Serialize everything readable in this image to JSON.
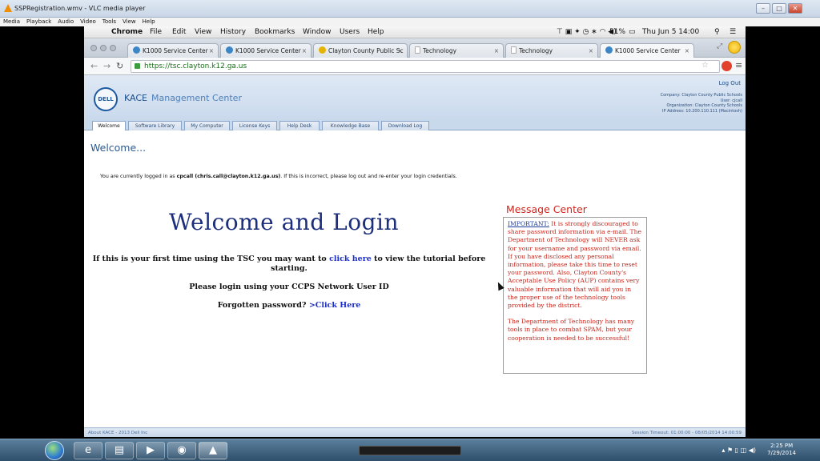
{
  "vlc": {
    "title": "SSPRegistration.wmv - VLC media player",
    "menu": [
      "Media",
      "Playback",
      "Audio",
      "Video",
      "Tools",
      "View",
      "Help"
    ]
  },
  "mac_menubar": {
    "app": "Chrome",
    "items": [
      "File",
      "Edit",
      "View",
      "History",
      "Bookmarks",
      "Window",
      "Users",
      "Help"
    ],
    "battery": "51%",
    "datetime": "Thu Jun 5  14:00"
  },
  "browser": {
    "tabs": [
      {
        "label": "K1000 Service Center",
        "icon": "kace-icon",
        "active": false
      },
      {
        "label": "K1000 Service Center",
        "icon": "kace-icon",
        "active": false
      },
      {
        "label": "Clayton County Public Sc",
        "icon": "county-icon",
        "active": false
      },
      {
        "label": "Technology",
        "icon": "doc-icon",
        "active": false
      },
      {
        "label": "Technology",
        "icon": "doc-icon",
        "active": false
      },
      {
        "label": "K1000 Service Center",
        "icon": "kace-icon",
        "active": true
      }
    ],
    "url": "https://tsc.clayton.k12.ga.us"
  },
  "kace": {
    "logo_text": "DELL",
    "product": "KACE",
    "subtitle": "Management Center",
    "logout": "Log Out",
    "company_lines": [
      "Company: Clayton County Public Schools",
      "User: cjcall",
      "Organization: Clayton County Schools",
      "IP Address: 10.200.110.111 (Macintosh)"
    ],
    "tabs": [
      "Welcome",
      "Software Library",
      "My Computer",
      "License Keys",
      "Help Desk",
      "Knowledge Base",
      "Download Log"
    ],
    "active_tab": "Welcome",
    "welcome_heading": "Welcome...",
    "login_notice_prefix": "You are currently logged in as ",
    "login_user": "cpcall (chris.call@clayton.k12.ga.us)",
    "login_notice_suffix": ".  If this is incorrect, please log out and re-enter your login credentials.",
    "wl_title": "Welcome and Login",
    "first_time_prefix": "If this is your first time using the TSC you may want to ",
    "first_time_link": "click here",
    "first_time_suffix": " to view the tutorial before starting.",
    "please_login": "Please login using your CCPS Network User ID",
    "forgot_prefix": "Forgotten password? ",
    "forgot_link": ">Click Here",
    "message_center_title": "Message Center",
    "message_important": "IMPORTANT:",
    "message_p1": " It is strongly discouraged to share password information via e-mail. The Department of Technology will NEVER ask for your username and password via email.  If you have disclosed any personal information, please take this time to reset your password.  Also, Clayton County's Acceptable Use Policy (AUP) contains very valuable information that will aid you in the proper use of the technology tools provided by the district.",
    "message_p2": "The Department of Technology has many tools in place to combat SPAM, but your cooperation is needed to be successful!",
    "footer_left": "About KACE - 2013 Dell Inc",
    "footer_right": "Session Timeout: 01:00:00 - 08/05/2014 14:00:59"
  },
  "taskbar": {
    "time": "2:25 PM",
    "date": "7/29/2014"
  }
}
